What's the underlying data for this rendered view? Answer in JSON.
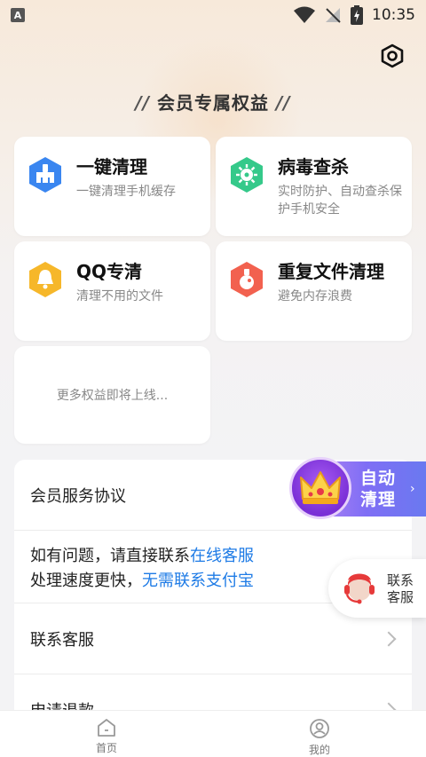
{
  "status": {
    "time": "10:35",
    "badge": "A"
  },
  "header": {
    "title": "会员专属权益",
    "slash_left": "//",
    "slash_right": "//",
    "settings_icon": "settings-hex-icon"
  },
  "features": [
    {
      "title": "一键清理",
      "subtitle": "一键清理手机缓存",
      "icon": "broom-icon",
      "color": "#3a86f0"
    },
    {
      "title": "病毒查杀",
      "subtitle": "实时防护、自动查杀保护手机安全",
      "icon": "virus-icon",
      "color": "#35c98a"
    },
    {
      "title": "QQ专清",
      "subtitle": "清理不用的文件",
      "icon": "bell-icon",
      "color": "#f6b72a"
    },
    {
      "title": "重复文件清理",
      "subtitle": "避免内存浪费",
      "icon": "bottle-icon",
      "color": "#f2614f"
    }
  ],
  "more": "更多权益即将上线...",
  "list": {
    "agreement": "会员服务协议",
    "contact_line1_prefix": "如有问题，请直接联系",
    "contact_line1_link": "在线客服",
    "contact_line2_prefix": "处理速度更快，",
    "contact_line2_link": "无需联系支付宝",
    "customer_service": "联系客服",
    "refund": "申请退款"
  },
  "floating": {
    "auto_line1": "自动",
    "auto_line2": "清理",
    "service_line1": "联系",
    "service_line2": "客服"
  },
  "tabbar": {
    "home": "首页",
    "mine": "我的"
  }
}
